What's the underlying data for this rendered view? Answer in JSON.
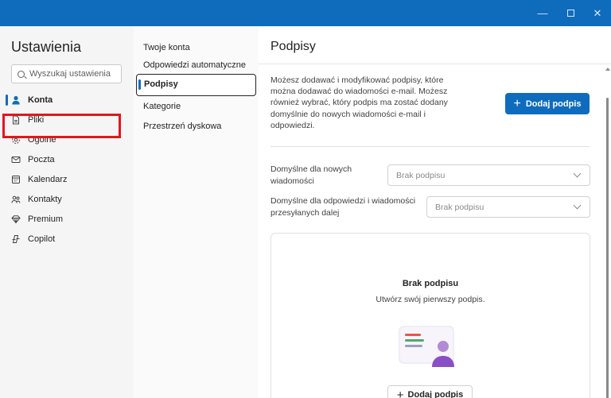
{
  "window": {
    "controls": {
      "minimize": "—",
      "close": "✕"
    }
  },
  "nav": {
    "title": "Ustawienia",
    "search_placeholder": "Wyszukaj ustawienia",
    "items": [
      {
        "label": "Konta",
        "icon": "person-icon",
        "active": true
      },
      {
        "label": "Pliki",
        "icon": "file-icon"
      },
      {
        "label": "Ogólne",
        "icon": "gear-icon"
      },
      {
        "label": "Poczta",
        "icon": "mail-icon"
      },
      {
        "label": "Kalendarz",
        "icon": "calendar-icon"
      },
      {
        "label": "Kontakty",
        "icon": "people-icon"
      },
      {
        "label": "Premium",
        "icon": "diamond-icon"
      },
      {
        "label": "Copilot",
        "icon": "copilot-icon"
      }
    ]
  },
  "subnav": {
    "items": [
      {
        "label": "Twoje konta"
      },
      {
        "label": "Odpowiedzi automatyczne"
      },
      {
        "label": "Podpisy",
        "active": true
      },
      {
        "label": "Kategorie"
      },
      {
        "label": "Przestrzeń dyskowa"
      }
    ]
  },
  "main": {
    "title": "Podpisy",
    "description": "Możesz dodawać i modyfikować podpisy, które można dodawać do wiadomości e-mail. Możesz również wybrać, który podpis ma zostać dodany domyślnie do nowych wiadomości e-mail i odpowiedzi.",
    "add_button": "Dodaj podpis",
    "default_new": {
      "label": "Domyślne dla nowych wiadomości",
      "value": "Brak podpisu"
    },
    "default_reply": {
      "label": "Domyślne dla odpowiedzi i wiadomości przesyłanych dalej",
      "value": "Brak podpisu"
    },
    "empty_state": {
      "title": "Brak podpisu",
      "subtitle": "Utwórz swój pierwszy podpis.",
      "button": "Dodaj podpis"
    }
  },
  "colors": {
    "accent": "#0f6cbd",
    "highlight": "#e3161c"
  }
}
